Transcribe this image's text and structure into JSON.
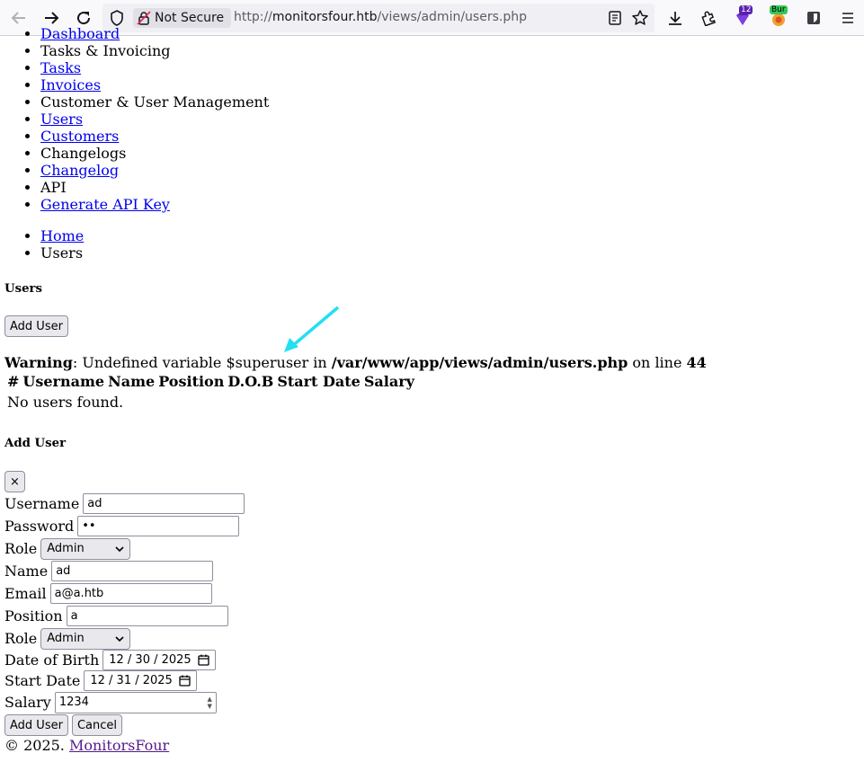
{
  "browser": {
    "security_label": "Not Secure",
    "url_scheme": "http://",
    "url_host": "monitorsfour.htb",
    "url_path": "/views/admin/users.php",
    "ext_badge_count": "12",
    "burp_badge": "Bur"
  },
  "menu": {
    "items": [
      {
        "label": "Dashboard",
        "link": true
      },
      {
        "label": "Tasks & Invoicing",
        "link": false
      },
      {
        "label": "Tasks",
        "link": true
      },
      {
        "label": "Invoices",
        "link": true
      },
      {
        "label": "Customer & User Management",
        "link": false
      },
      {
        "label": "Users",
        "link": true
      },
      {
        "label": "Customers",
        "link": true
      },
      {
        "label": "Changelogs",
        "link": false
      },
      {
        "label": "Changelog",
        "link": true
      },
      {
        "label": "API",
        "link": false
      },
      {
        "label": "Generate API Key",
        "link": true
      }
    ]
  },
  "breadcrumb": {
    "home": "Home",
    "current": "Users"
  },
  "page": {
    "title": "Users",
    "add_user_button": "Add User"
  },
  "warning": {
    "label": "Warning",
    "message": ": Undefined variable $superuser in ",
    "path": "/var/www/app/views/admin/users.php",
    "on_line": " on line ",
    "line": "44"
  },
  "table": {
    "headers": [
      "#",
      "Username",
      "Name",
      "Position",
      "D.O.B",
      "Start Date",
      "Salary"
    ],
    "empty_text": "No users found."
  },
  "modal": {
    "title": "Add User",
    "close_label": "×",
    "fields": {
      "username_label": "Username",
      "username_value": "ad",
      "password_label": "Password",
      "password_value": "••",
      "role_label": "Role",
      "role_value": "Admin",
      "name_label": "Name",
      "name_value": "ad",
      "email_label": "Email",
      "email_value": "a@a.htb",
      "position_label": "Position",
      "position_value": "a",
      "role2_label": "Role",
      "role2_value": "Admin",
      "dob_label": "Date of Birth",
      "dob_value": "12 / 30 / 2025",
      "start_label": "Start Date",
      "start_value": "12 / 31 / 2025",
      "salary_label": "Salary",
      "salary_value": "1234"
    },
    "submit_label": "Add User",
    "cancel_label": "Cancel"
  },
  "footer": {
    "copyright": "© 2025. ",
    "brand": "MonitorsFour"
  },
  "colors": {
    "link": "#0000ee",
    "visited": "#551a8b",
    "annotation_arrow": "#22e0f0"
  }
}
